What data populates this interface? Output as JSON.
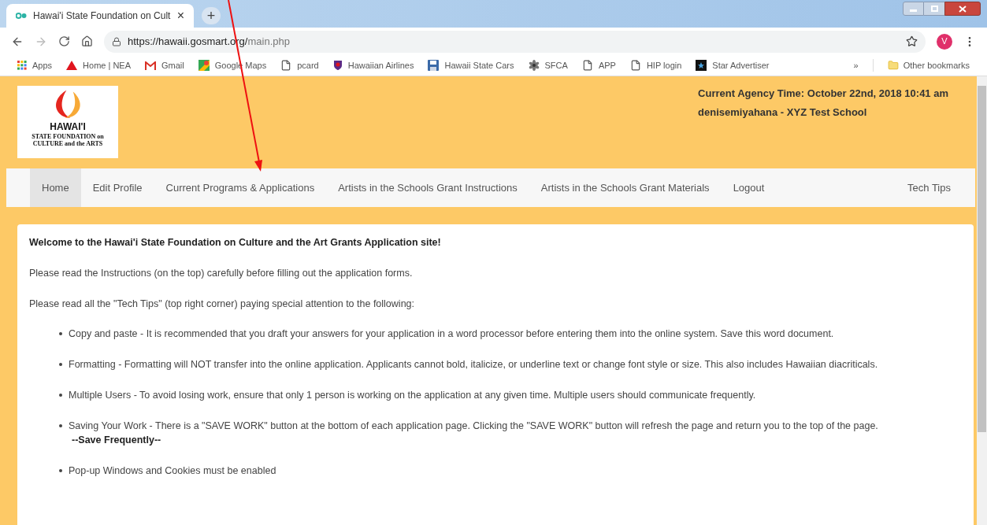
{
  "browser": {
    "tab": {
      "title": "Hawai'i State Foundation on Cult",
      "close": "×",
      "new_tab": "+"
    },
    "url": {
      "host": "https://hawaii.gosmart.org/",
      "path": "main.php"
    },
    "avatar": "V",
    "bookmarks": [
      {
        "label": "Apps",
        "kind": "apps"
      },
      {
        "label": "Home | NEA",
        "kind": "triangle"
      },
      {
        "label": "Gmail",
        "kind": "mail"
      },
      {
        "label": "Google Maps",
        "kind": "map"
      },
      {
        "label": "pcard",
        "kind": "page"
      },
      {
        "label": "Hawaiian Airlines",
        "kind": "shield"
      },
      {
        "label": "Hawaii State Cars",
        "kind": "disk"
      },
      {
        "label": "SFCA",
        "kind": "flower"
      },
      {
        "label": "APP",
        "kind": "page"
      },
      {
        "label": "HIP login",
        "kind": "page"
      },
      {
        "label": "Star Advertiser",
        "kind": "star"
      }
    ],
    "more": "»",
    "other_bookmarks": "Other bookmarks"
  },
  "header": {
    "logo": {
      "title": "HAWAI'I",
      "line_1": "STATE FOUNDATION on",
      "line_2": "CULTURE and the ARTS"
    },
    "agency_time": "Current Agency Time: October 22nd, 2018 10:41 am",
    "user": "denisemiyahana - XYZ Test School"
  },
  "nav": [
    {
      "label": "Home",
      "selected": true
    },
    {
      "label": "Edit Profile",
      "selected": false
    },
    {
      "label": "Current Programs & Applications",
      "selected": false
    },
    {
      "label": "Artists in the Schools Grant Instructions",
      "selected": false
    },
    {
      "label": "Artists in the Schools Grant Materials",
      "selected": false
    },
    {
      "label": "Logout",
      "selected": false
    }
  ],
  "nav_right": {
    "label": "Tech Tips",
    "selected": false
  },
  "content": {
    "heading": "Welcome to the Hawai'i State Foundation on Culture and the Art Grants Application site!",
    "paragraphs": [
      "Please read the Instructions (on the top) carefully before filling out the application forms.",
      "Please read all the \"Tech Tips\" (top right corner) paying special attention to the following:"
    ],
    "bullets": [
      {
        "text": "Copy and paste - It is recommended that you draft your answers for your application in a word processor before entering them into the online system. Save this word document."
      },
      {
        "text": "Formatting - Formatting will NOT transfer into the online application. Applicants cannot bold, italicize, or underline text or change font style or size. This also includes Hawaiian diacriticals."
      },
      {
        "text": "Multiple Users - To avoid losing work, ensure that only 1 person is working on the application at any given time. Multiple users should communicate frequently."
      },
      {
        "text": "Saving Your Work - There is a \"SAVE WORK\" button at the bottom of each application page.  Clicking the \"SAVE WORK\" button will refresh the page and return you to the top of the page.",
        "note": "--Save Frequently--"
      },
      {
        "text": "Pop-up Windows and Cookies must be enabled"
      }
    ]
  }
}
